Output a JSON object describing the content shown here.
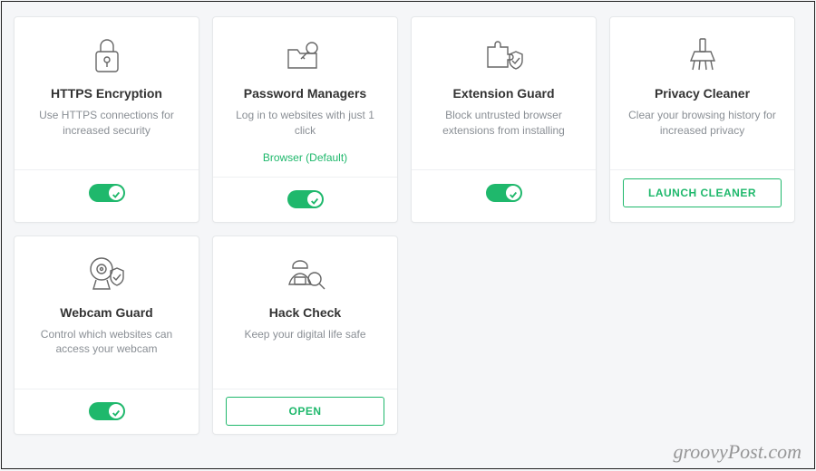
{
  "cards": [
    {
      "id": "https-encryption",
      "icon": "lock-icon",
      "title": "HTTPS Encryption",
      "desc": "Use HTTPS connections for increased security",
      "extra": "",
      "footer_type": "toggle",
      "footer_label": "",
      "toggle_on": true
    },
    {
      "id": "password-managers",
      "icon": "key-folder-icon",
      "title": "Password Managers",
      "desc": "Log in to websites with just 1 click",
      "extra": "Browser (Default)",
      "footer_type": "toggle",
      "footer_label": "",
      "toggle_on": true
    },
    {
      "id": "extension-guard",
      "icon": "puzzle-shield-icon",
      "title": "Extension Guard",
      "desc": "Block untrusted browser extensions from installing",
      "extra": "",
      "footer_type": "toggle",
      "footer_label": "",
      "toggle_on": true
    },
    {
      "id": "privacy-cleaner",
      "icon": "brush-icon",
      "title": "Privacy Cleaner",
      "desc": "Clear your browsing history for increased privacy",
      "extra": "",
      "footer_type": "button",
      "footer_label": "LAUNCH CLEANER",
      "toggle_on": false
    },
    {
      "id": "webcam-guard",
      "icon": "webcam-shield-icon",
      "title": "Webcam Guard",
      "desc": "Control which websites can access your webcam",
      "extra": "",
      "footer_type": "toggle",
      "footer_label": "",
      "toggle_on": true
    },
    {
      "id": "hack-check",
      "icon": "hacker-search-icon",
      "title": "Hack Check",
      "desc": "Keep your digital life safe",
      "extra": "",
      "footer_type": "button",
      "footer_label": "OPEN",
      "toggle_on": false
    }
  ],
  "watermark": "groovyPost.com",
  "colors": {
    "accent": "#1fb86c"
  }
}
